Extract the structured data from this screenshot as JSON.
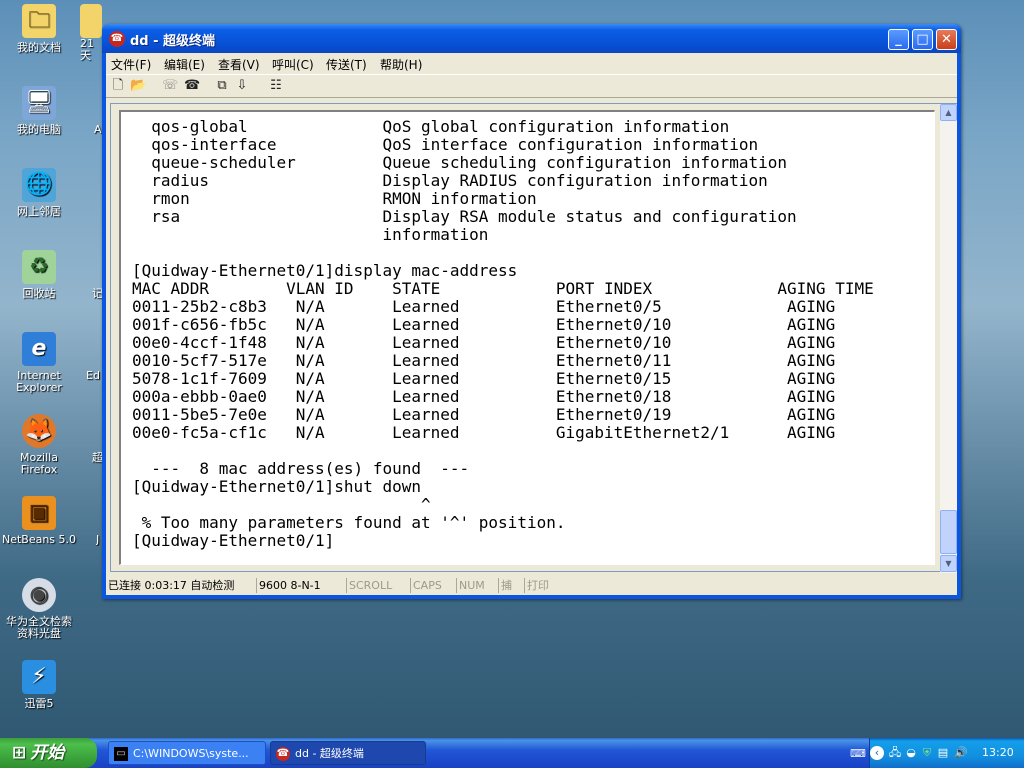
{
  "desktop": {
    "icons": [
      {
        "label": "我的文档"
      },
      {
        "label": "我的电脑"
      },
      {
        "label": "网上邻居"
      },
      {
        "label": "回收站"
      },
      {
        "label": "Internet Explorer"
      },
      {
        "label": "Mozilla Firefox"
      },
      {
        "label": "NetBeans 5.0"
      },
      {
        "label": "华为全文检索资料光盘"
      },
      {
        "label": "迅雷5"
      }
    ],
    "partial_labels": [
      "21天",
      "A",
      "记",
      "Ed",
      "超",
      "J"
    ]
  },
  "window": {
    "title": "dd - 超级终端",
    "buttons": {
      "minimize": "_",
      "maximize": "□",
      "close": "✕"
    }
  },
  "menu": {
    "items": [
      {
        "label": "文件(F)"
      },
      {
        "label": "编辑(E)"
      },
      {
        "label": "查看(V)"
      },
      {
        "label": "呼叫(C)"
      },
      {
        "label": "传送(T)"
      },
      {
        "label": "帮助(H)"
      }
    ]
  },
  "toolbar": {
    "icons": [
      "new-icon",
      "open-icon",
      "disconnect-icon",
      "dial-icon",
      "send-icon",
      "receive-icon",
      "properties-icon"
    ]
  },
  "terminal": {
    "lines": [
      "  qos-global              QoS global configuration information",
      "  qos-interface           QoS interface configuration information",
      "  queue-scheduler         Queue scheduling configuration information",
      "  radius                  Display RADIUS configuration information",
      "  rmon                    RMON information",
      "  rsa                     Display RSA module status and configuration",
      "                          information",
      "",
      "[Quidway-Ethernet0/1]display mac-address",
      "MAC ADDR        VLAN ID    STATE            PORT INDEX             AGING TIME",
      "0011-25b2-c8b3   N/A       Learned          Ethernet0/5             AGING",
      "001f-c656-fb5c   N/A       Learned          Ethernet0/10            AGING",
      "00e0-4ccf-1f48   N/A       Learned          Ethernet0/10            AGING",
      "0010-5cf7-517e   N/A       Learned          Ethernet0/11            AGING",
      "5078-1c1f-7609   N/A       Learned          Ethernet0/15            AGING",
      "000a-ebbb-0ae0   N/A       Learned          Ethernet0/18            AGING",
      "0011-5be5-7e0e   N/A       Learned          Ethernet0/19            AGING",
      "00e0-fc5a-cf1c   N/A       Learned          GigabitEthernet2/1      AGING",
      "",
      "  ---  8 mac address(es) found  ---",
      "[Quidway-Ethernet0/1]shut down",
      "                              ^",
      " % Too many parameters found at '^' position.",
      "[Quidway-Ethernet0/1]"
    ]
  },
  "statusbar": {
    "connection": "已连接 0:03:17 自动检测",
    "settings": "9600 8-N-1",
    "scroll": "SCROLL",
    "caps": "CAPS",
    "num": "NUM",
    "capture": "捕",
    "print": "打印"
  },
  "taskbar": {
    "start_label": "开始",
    "tasks": [
      {
        "label": "C:\\WINDOWS\\syste..."
      },
      {
        "label": "dd - 超级终端"
      }
    ],
    "clock": "13:20"
  }
}
